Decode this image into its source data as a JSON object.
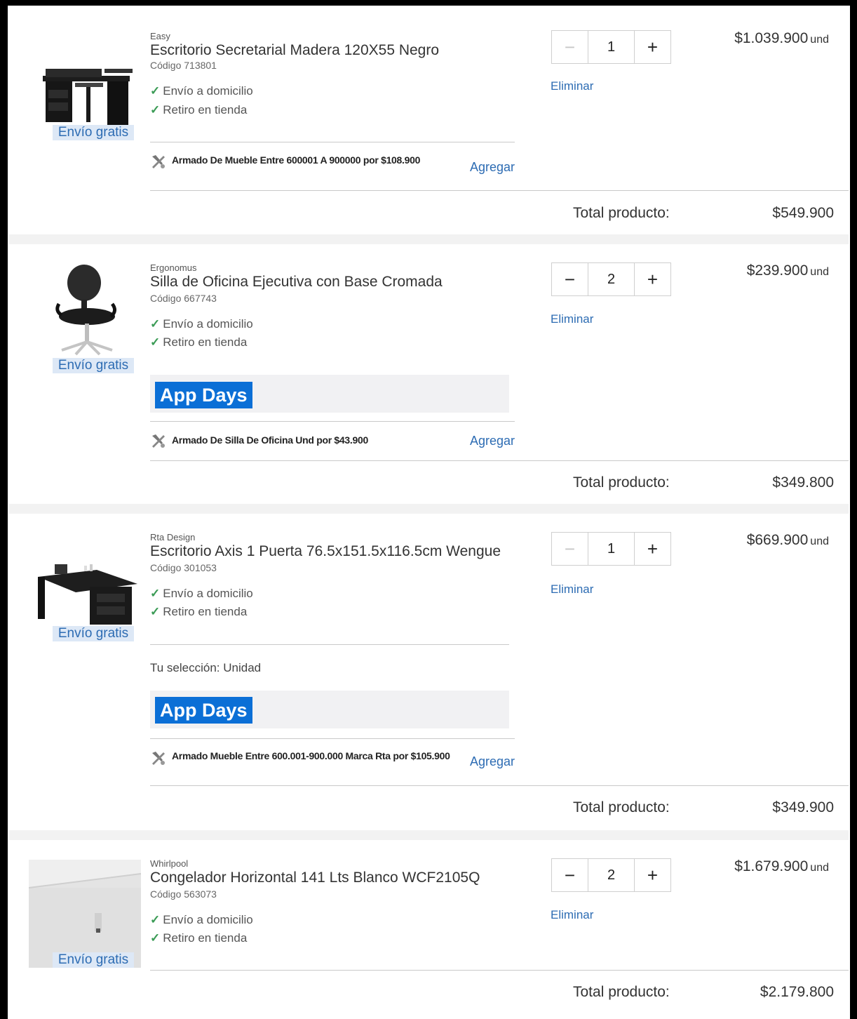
{
  "cart": {
    "items": [
      {
        "brand": "Easy",
        "title": "Escritorio Secretarial Madera 120X55 Negro",
        "code": "Código 713801",
        "ship_badge": "Envío gratis",
        "delivery": [
          "Envío a domicilio",
          "Retiro en tienda"
        ],
        "service_text": "Armado De Mueble Entre 600001 A 900000 por $108.900",
        "service_add": "Agregar",
        "quantity": "1",
        "decrement_enabled": false,
        "remove_label": "Eliminar",
        "unit_price": "$1.039.900",
        "unit_suffix": "und",
        "total_label": "Total producto:",
        "total_value": "$549.900"
      },
      {
        "brand": "Ergonomus",
        "title": "Silla de Oficina Ejecutiva con Base Cromada",
        "code": "Código 667743",
        "ship_badge": "Envío gratis",
        "delivery": [
          "Envío a domicilio",
          "Retiro en tienda"
        ],
        "promo_badge": "App Days",
        "service_text": "Armado De Silla De Oficina Und por $43.900",
        "service_add": "Agregar",
        "quantity": "2",
        "decrement_enabled": true,
        "remove_label": "Eliminar",
        "unit_price": "$239.900",
        "unit_suffix": "und",
        "total_label": "Total producto:",
        "total_value": "$349.800"
      },
      {
        "brand": "Rta Design",
        "title": "Escritorio Axis 1 Puerta 76.5x151.5x116.5cm Wengue",
        "code": "Código 301053",
        "ship_badge": "Envío gratis",
        "delivery": [
          "Envío a domicilio",
          "Retiro en tienda"
        ],
        "selection": "Tu selección: Unidad",
        "promo_badge": "App Days",
        "service_text": "Armado Mueble Entre 600.001-900.000 Marca Rta por $105.900",
        "service_add": "Agregar",
        "quantity": "1",
        "decrement_enabled": false,
        "remove_label": "Eliminar",
        "unit_price": "$669.900",
        "unit_suffix": "und",
        "total_label": "Total producto:",
        "total_value": "$349.900"
      },
      {
        "brand": "Whirlpool",
        "title": "Congelador Horizontal 141 Lts Blanco WCF2105Q",
        "code": "Código 563073",
        "ship_badge": "Envío gratis",
        "delivery": [
          "Envío a domicilio",
          "Retiro en tienda"
        ],
        "quantity": "2",
        "decrement_enabled": true,
        "remove_label": "Eliminar",
        "unit_price": "$1.679.900",
        "unit_suffix": "und",
        "total_label": "Total producto:",
        "total_value": "$2.179.800"
      }
    ]
  },
  "icons": {
    "check": "check-icon",
    "service": "tools-icon",
    "minus": "minus-icon",
    "plus": "plus-icon"
  },
  "colors": {
    "link": "#2d6cb3",
    "check": "#3a9b55",
    "app_days": "#0b6fd6",
    "ship_badge_bg": "#dde8f6"
  }
}
